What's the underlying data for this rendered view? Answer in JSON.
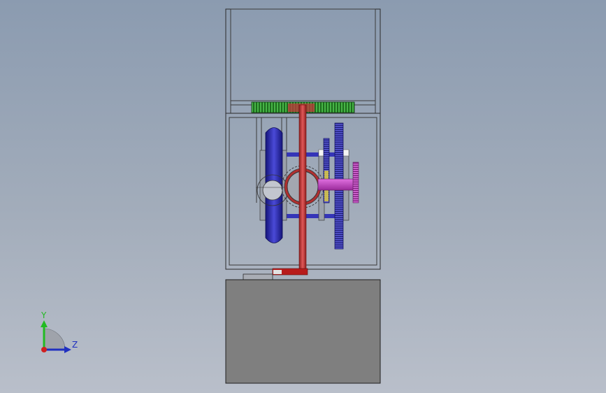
{
  "viewport": {
    "background_top": "#8b9bb0",
    "background_bottom": "#b9bfca"
  },
  "triad": {
    "y_label": "Y",
    "z_label": "Z",
    "y_color": "#22bb22",
    "z_color": "#2030c0",
    "x_color": "#d02020"
  },
  "model": {
    "shaft_color": "#c43a3a",
    "gear_blue": "#2d2d9a",
    "gear_green": "#2f8f2f",
    "gear_magenta": "#b040b0",
    "housing_fill": "#7f7f7f",
    "frame_stroke": "#2a2a2a"
  }
}
